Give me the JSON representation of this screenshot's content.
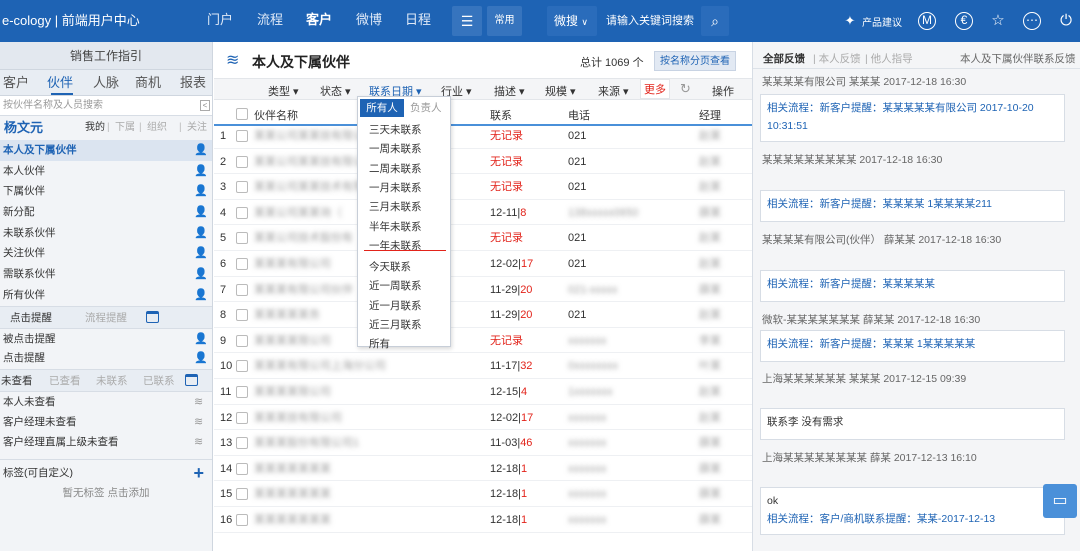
{
  "app": {
    "title": "e-cology | 前端用户中心"
  },
  "topnav": {
    "items": [
      "门户",
      "流程",
      "客户",
      "微博",
      "日程"
    ],
    "active_index": 2,
    "menu_btn": "常用",
    "search_btn": "微搜",
    "search_placeholder": "请输入关键词搜索",
    "product_suggest": "产品建议"
  },
  "sidebar": {
    "title": "销售工作指引",
    "tabs": [
      "客户",
      "伙伴",
      "人脉",
      "商机",
      "报表"
    ],
    "active_tab": 1,
    "search_placeholder": "按伙伴名称及人员搜索",
    "user": "杨文元",
    "user_filters": [
      "我的",
      "下属",
      "组织",
      "关注"
    ],
    "items": [
      "本人及下属伙伴",
      "本人伙伴",
      "下属伙伴",
      "新分配",
      "未联系伙伴",
      "关注伙伴",
      "需联系伙伴",
      "所有伙伴"
    ],
    "remind_tabs": [
      "点击提醒",
      "流程提醒"
    ],
    "remind_items": [
      "被点击提醒",
      "点击提醒"
    ],
    "view_tabs": [
      "未查看",
      "已查看",
      "未联系",
      "已联系"
    ],
    "view_items": [
      "本人未查看",
      "客户经理未查看",
      "客户经理直属上级未查看"
    ],
    "tag_title": "标签(可自定义)",
    "tag_empty": "暂无标签 点击添加"
  },
  "main": {
    "title": "本人及下属伙伴",
    "total": "总计 1069 个",
    "view_btn": "按名称分页查看",
    "filters": [
      "类型",
      "状态",
      "联系日期",
      "行业",
      "描述",
      "规模",
      "来源",
      "更多"
    ],
    "op_label": "操作",
    "columns": [
      "伙伴名称",
      "联系",
      "电话",
      "经理"
    ],
    "rows": [
      {
        "num": "1",
        "name": "某某公司某某技有限公司",
        "contact": "无记录",
        "phone": "021",
        "mgr": "赵某"
      },
      {
        "num": "2",
        "name": "某某公司某某技有限公司",
        "contact": "无记录",
        "phone": "021",
        "mgr": "赵某"
      },
      {
        "num": "3",
        "name": "某某公司某某技术有限",
        "contact": "无记录",
        "phone": "021",
        "mgr": "赵某"
      },
      {
        "num": "4",
        "name": "某某公司某某询（",
        "contact": "12-11|8",
        "phone": "138xxxxx0650",
        "mgr": "薛某"
      },
      {
        "num": "5",
        "name": "某某公司技术股份有",
        "contact": "无记录",
        "phone": "021",
        "mgr": "赵某"
      },
      {
        "num": "6",
        "name": "某某某有限公司",
        "contact": "12-02|17",
        "phone": "021",
        "mgr": "赵某"
      },
      {
        "num": "7",
        "name": "某某某有限公司伙伴",
        "contact": "11-29|20",
        "phone": "021-xxxxx",
        "mgr": "薛某"
      },
      {
        "num": "8",
        "name": "某某某某某务",
        "contact": "11-29|20",
        "phone": "021",
        "mgr": "赵某"
      },
      {
        "num": "9",
        "name": "某某某某限公司",
        "contact": "无记录",
        "phone": "xxxxxxx",
        "mgr": "李某"
      },
      {
        "num": "10",
        "name": "某某某有限公司上海分公司",
        "contact": "11-17|32",
        "phone": "0xxxxxxxx",
        "mgr": "叶某"
      },
      {
        "num": "11",
        "name": "某某某某限公司",
        "contact": "12-15|4",
        "phone": "1xxxxxxx",
        "mgr": "赵某"
      },
      {
        "num": "12",
        "name": "某某某技有限公司",
        "contact": "12-02|17",
        "phone": "xxxxxxx",
        "mgr": "赵某"
      },
      {
        "num": "13",
        "name": "某某某股份有限公司1",
        "contact": "11-03|46",
        "phone": "xxxxxxx",
        "mgr": "薛某"
      },
      {
        "num": "14",
        "name": "某某某某某某某",
        "contact": "12-18|1",
        "phone": "xxxxxxx",
        "mgr": "薛某"
      },
      {
        "num": "15",
        "name": "某某某某某某某",
        "contact": "12-18|1",
        "phone": "xxxxxxx",
        "mgr": "薛某"
      },
      {
        "num": "16",
        "name": "某某某某某某某",
        "contact": "12-18|1",
        "phone": "xxxxxxx",
        "mgr": "薛某"
      }
    ]
  },
  "dropdown": {
    "tabs": [
      "所有人",
      "负责人"
    ],
    "items": [
      "三天未联系",
      "一周未联系",
      "二周未联系",
      "一月未联系",
      "三月未联系",
      "半年未联系",
      "一年未联系",
      "今天联系",
      "近一周联系",
      "近一月联系",
      "近三月联系",
      "所有"
    ]
  },
  "right_panel": {
    "tabs": [
      "全部反馈",
      "本人反馈",
      "他人指导"
    ],
    "header": "本人及下属伙伴联系反馈",
    "feeds": [
      {
        "meta": "某某某某有限公司 某某某 2017-12-18 16:30",
        "body": "相关流程：新客户提醒：某某某某某有限公司 2017-10-20 10:31:51"
      },
      {
        "meta": "某某某某某某某某某 2017-12-18 16:30",
        "body": "相关流程：新客户提醒：某某某某 1某某某某211"
      },
      {
        "meta": "某某某某有限公司(伙伴） 薛某某 2017-12-18 16:30",
        "body": "相关流程：新客户提醒：某某某某某"
      },
      {
        "meta": "微软-某某某某某某某 薛某某 2017-12-18 16:30",
        "body": "相关流程：新客户提醒：某某某 1某某某某某"
      },
      {
        "meta": "上海某某某某某某 某某某 2017-12-15 09:39",
        "body": "联系李 没有需求"
      },
      {
        "meta": "上海某某某某某某某某 薛某 2017-12-13 16:10",
        "body": "ok|相关流程：客户/商机联系提醒：某某-2017-12-13"
      }
    ]
  }
}
